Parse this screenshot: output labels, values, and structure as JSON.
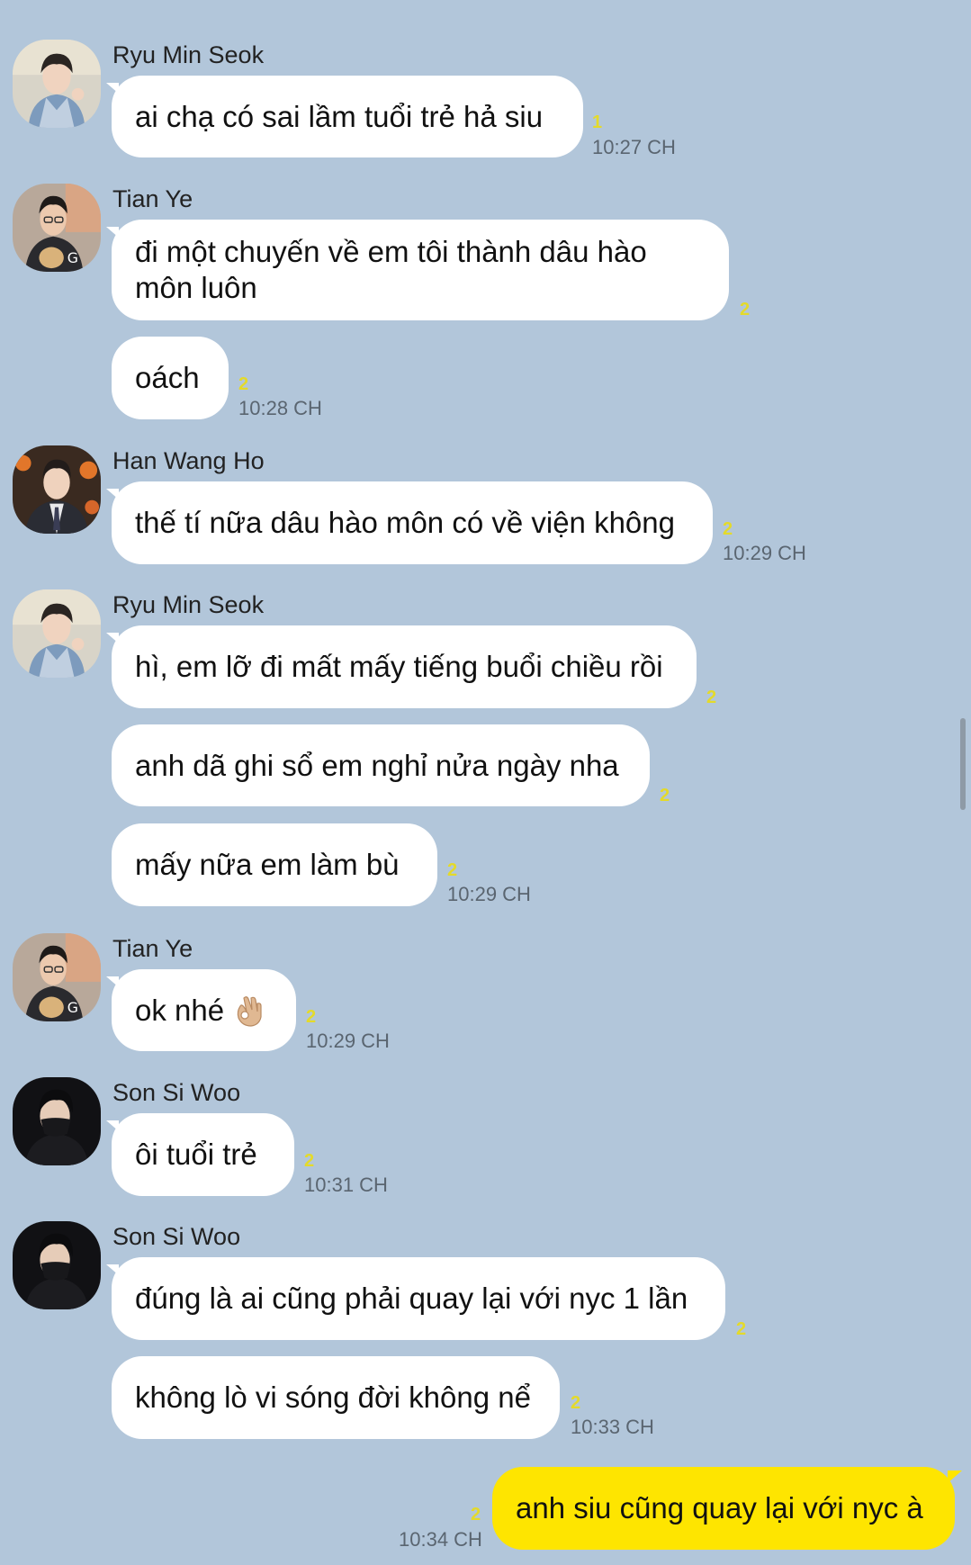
{
  "messages": [
    {
      "sender": "Ryu Min Seok",
      "text": "ai chạ có sai lầm tuổi trẻ hả siu",
      "unread": "1",
      "time": "10:27 CH"
    },
    {
      "sender": "Tian Ye",
      "text": "đi một chuyến về em tôi thành dâu hào môn luôn",
      "unread": "2",
      "time": ""
    },
    {
      "sender": "",
      "text": "oách",
      "unread": "2",
      "time": "10:28 CH"
    },
    {
      "sender": "Han Wang Ho",
      "text": "thế tí nữa dâu hào môn có về viện không",
      "unread": "2",
      "time": "10:29 CH"
    },
    {
      "sender": "Ryu Min Seok",
      "text": "hì, em lỡ đi mất mấy tiếng buổi chiều rồi",
      "unread": "2",
      "time": ""
    },
    {
      "sender": "",
      "text": "anh dã ghi sổ em nghỉ nửa ngày nha",
      "unread": "2",
      "time": ""
    },
    {
      "sender": "",
      "text": "mấy nữa em làm bù",
      "unread": "2",
      "time": "10:29 CH"
    },
    {
      "sender": "Tian Ye",
      "text": "ok nhé",
      "emoji": "ok-hand-icon",
      "unread": "2",
      "time": "10:29 CH"
    },
    {
      "sender": "Son Si Woo",
      "text": "ôi tuổi trẻ",
      "unread": "2",
      "time": "10:31 CH"
    },
    {
      "sender": "Son Si Woo",
      "text": "đúng là ai cũng phải quay lại với nyc 1 lần",
      "unread": "2",
      "time": ""
    },
    {
      "sender": "",
      "text": "không lò vi sóng đời không nể",
      "unread": "2",
      "time": "10:33 CH"
    },
    {
      "sender": "me",
      "text": "anh siu cũng quay lại với nyc à",
      "unread": "2",
      "time": "10:34 CH"
    }
  ],
  "colors": {
    "background": "#b2c6da",
    "incoming_bubble": "#ffffff",
    "outgoing_bubble": "#fee500",
    "unread_count": "#e4da2a"
  }
}
